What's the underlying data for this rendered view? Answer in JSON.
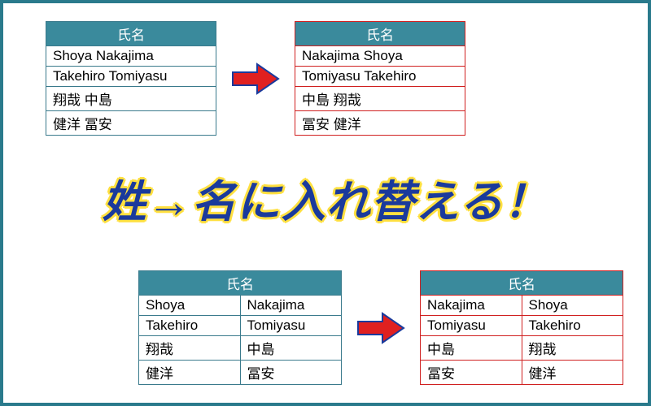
{
  "headline": "姓→名に入れ替える！",
  "header_label": "氏名",
  "top_left_table": {
    "rows": [
      "Shoya  Nakajima",
      "Takehiro Tomiyasu",
      "翔哉 中島",
      "健洋 冨安"
    ]
  },
  "top_right_table": {
    "rows": [
      "Nakajima Shoya",
      "Tomiyasu Takehiro",
      "中島 翔哉",
      "冨安 健洋"
    ]
  },
  "bottom_left_table": {
    "rows": [
      [
        "Shoya",
        "Nakajima"
      ],
      [
        "Takehiro",
        "Tomiyasu"
      ],
      [
        "翔哉",
        "中島"
      ],
      [
        "健洋",
        "冨安"
      ]
    ]
  },
  "bottom_right_table": {
    "rows": [
      [
        "Nakajima",
        "Shoya"
      ],
      [
        "Tomiyasu",
        "Takehiro"
      ],
      [
        "中島",
        "翔哉"
      ],
      [
        "冨安",
        "健洋"
      ]
    ]
  },
  "colors": {
    "border_main": "#2a7a8c",
    "table_header_bg": "#3a8a9c",
    "blue_border": "#3a7a8c",
    "red_border": "#d02020",
    "headline_fill": "#1a3a9c",
    "headline_outline": "#ffe040",
    "arrow_fill": "#e02020",
    "arrow_stroke": "#1a3a9c"
  }
}
